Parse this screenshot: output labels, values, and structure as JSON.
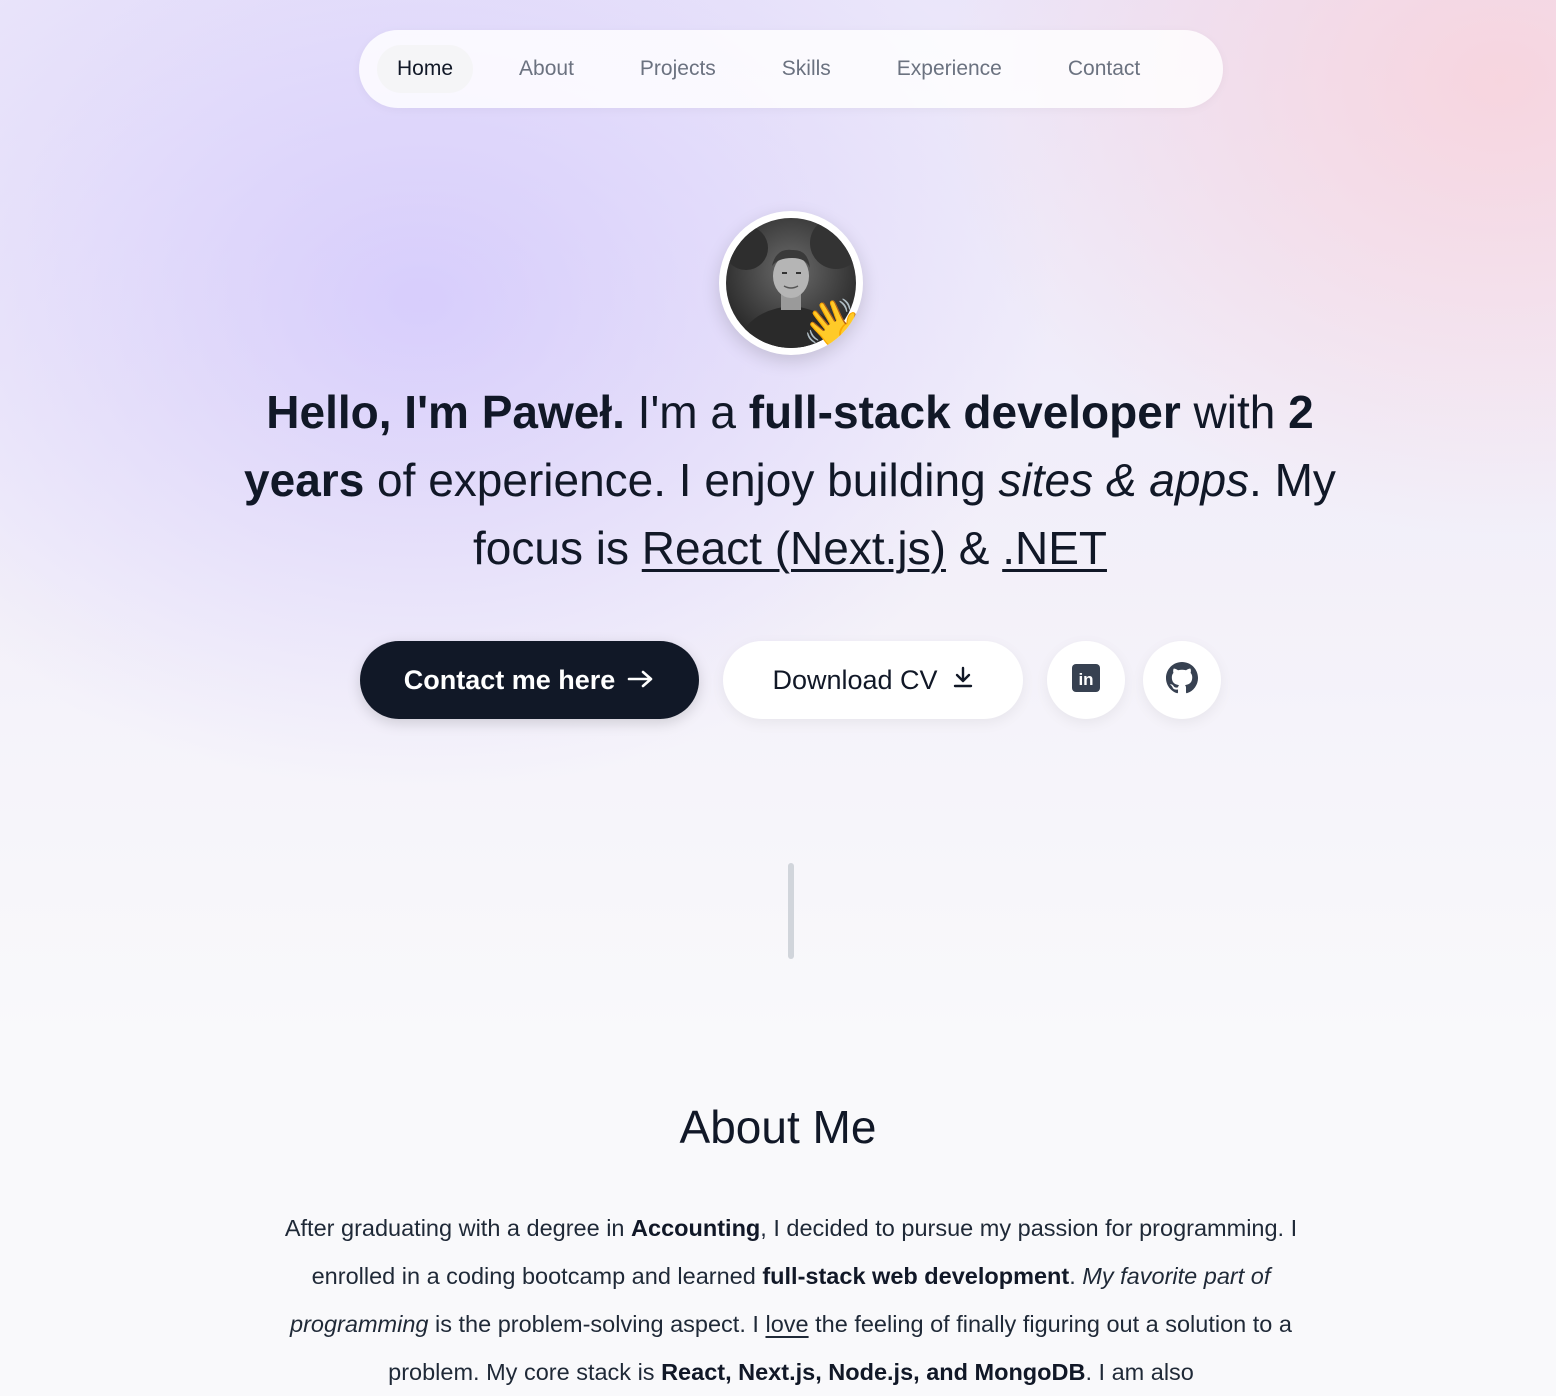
{
  "nav": {
    "items": [
      {
        "label": "Home",
        "active": true
      },
      {
        "label": "About",
        "active": false
      },
      {
        "label": "Projects",
        "active": false
      },
      {
        "label": "Skills",
        "active": false
      },
      {
        "label": "Experience",
        "active": false
      },
      {
        "label": "Contact",
        "active": false
      }
    ]
  },
  "hero": {
    "avatar_emoji": "👋",
    "headline": {
      "greeting": "Hello, I'm Paweł.",
      "im_a": " I'm a ",
      "role": "full-stack developer",
      "with": " with ",
      "years": "2 years",
      "experience": " of experience. I enjoy building ",
      "sites": "sites & apps",
      "focus": ". My focus is ",
      "react": "React (Next.js)",
      "amp": " & ",
      "dotnet": ".NET"
    },
    "contact_button": "Contact me here",
    "cv_button": "Download CV",
    "linkedin_label": "in"
  },
  "about": {
    "title": "About Me",
    "p1": "After graduating with a degree in ",
    "accounting": "Accounting",
    "p2": ", I decided to pursue my passion for programming. I enrolled in a coding bootcamp and learned ",
    "fullstack": "full-stack web development",
    "p3": ". ",
    "favorite": "My favorite part of programming",
    "p4": " is the problem-solving aspect. I ",
    "love": "love",
    "p5": " the feeling of finally figuring out a solution to a problem. My core stack is ",
    "stack": "React, Next.js, Node.js, and MongoDB",
    "p6": ". I am also"
  },
  "colors": {
    "primary": "#111827",
    "muted": "#6b7280",
    "divider": "#d1d5db"
  },
  "icons": [
    "arrow-right-icon",
    "download-icon",
    "linkedin-icon",
    "github-icon",
    "waving-hand-icon"
  ]
}
